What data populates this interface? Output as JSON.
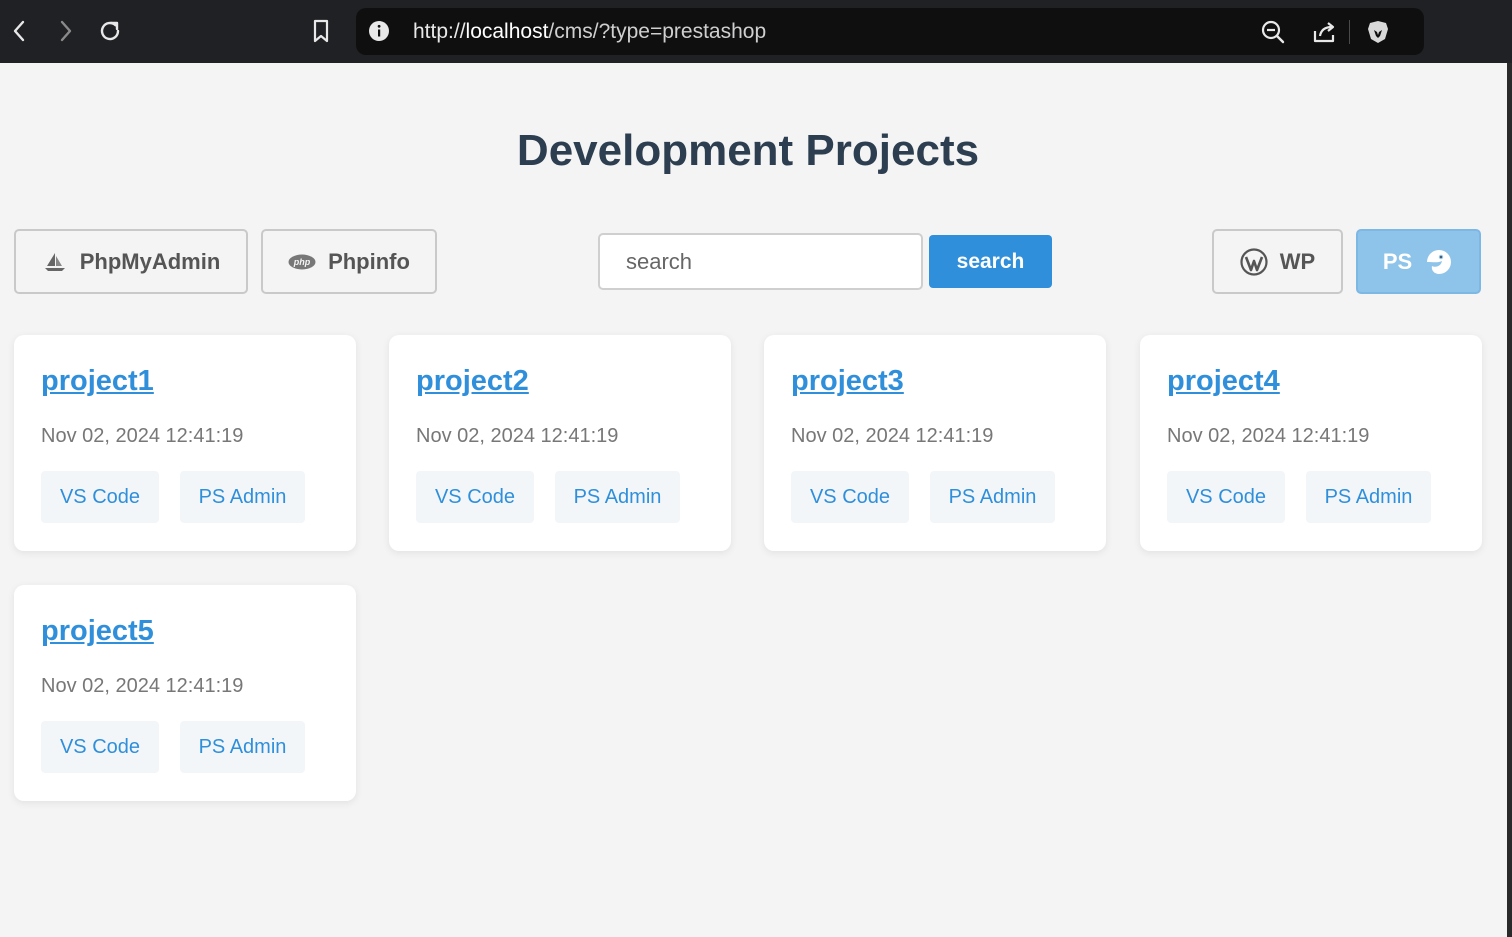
{
  "browser": {
    "url_prefix": "http://",
    "url_host": "localhost",
    "url_path": "/cms/?type=prestashop"
  },
  "page": {
    "title": "Development Projects"
  },
  "toolbar": {
    "phpmyadmin_label": "PhpMyAdmin",
    "phpinfo_label": "Phpinfo",
    "search_placeholder": "search",
    "search_value": "",
    "search_button_label": "search",
    "wp_label": "WP",
    "ps_label": "PS"
  },
  "projects": [
    {
      "name": "project1",
      "date": "Nov 02, 2024 12:41:19",
      "vscode_label": "VS Code",
      "admin_label": "PS Admin"
    },
    {
      "name": "project2",
      "date": "Nov 02, 2024 12:41:19",
      "vscode_label": "VS Code",
      "admin_label": "PS Admin"
    },
    {
      "name": "project3",
      "date": "Nov 02, 2024 12:41:19",
      "vscode_label": "VS Code",
      "admin_label": "PS Admin"
    },
    {
      "name": "project4",
      "date": "Nov 02, 2024 12:41:19",
      "vscode_label": "VS Code",
      "admin_label": "PS Admin"
    },
    {
      "name": "project5",
      "date": "Nov 02, 2024 12:41:19",
      "vscode_label": "VS Code",
      "admin_label": "PS Admin"
    }
  ],
  "colors": {
    "accent": "#2f8fdb",
    "title": "#2c3e50",
    "ps_active": "#8ec3ea"
  }
}
